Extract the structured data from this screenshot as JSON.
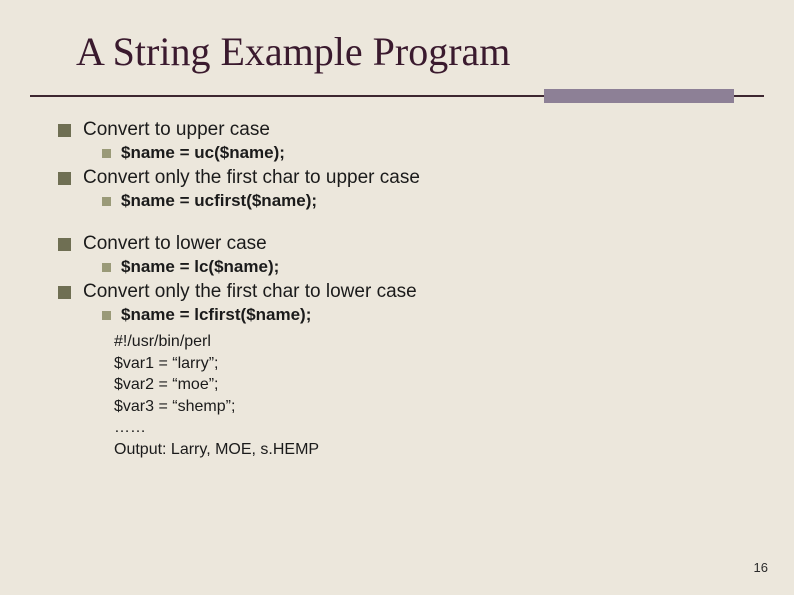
{
  "title": "A String Example Program",
  "bullets": {
    "a": {
      "text": "Convert to upper case",
      "sub": "$name = uc($name);"
    },
    "b": {
      "text": "Convert only the first char to upper case",
      "sub": "$name = ucfirst($name);"
    },
    "c": {
      "text": "Convert to lower case",
      "sub": "$name = lc($name);"
    },
    "d": {
      "text": "Convert only the first char to lower case",
      "sub": "$name = lcfirst($name);"
    }
  },
  "code": {
    "l1": "#!/usr/bin/perl",
    "l2": "$var1 = “larry”;",
    "l3": "$var2 = “moe”;",
    "l4": "$var3 = “shemp”;",
    "l5": "……",
    "l6": "Output: Larry, MOE, s.HEMP"
  },
  "page": "16"
}
